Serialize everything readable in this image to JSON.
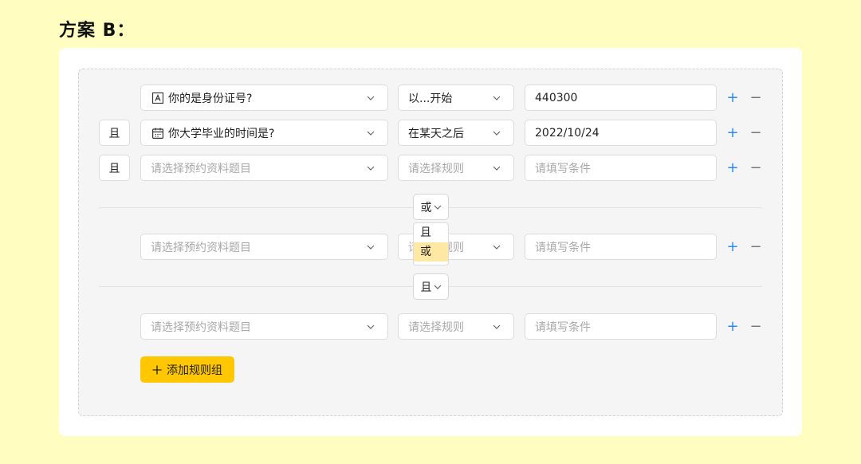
{
  "page_title": "方案 B：",
  "logic_words": {
    "and": "且",
    "or": "或"
  },
  "rows": [
    {
      "question": "你的是身份证号?",
      "question_icon": "text-field-icon",
      "rule": "以...开始",
      "value": "440300"
    },
    {
      "logic": "且",
      "question": "你大学毕业的时间是?",
      "question_icon": "calendar-icon",
      "rule": "在某天之后",
      "value": "2022/10/24"
    },
    {
      "logic": "且",
      "question_placeholder": "请选择预约资料题目",
      "rule_placeholder": "请选择规则",
      "value_placeholder": "请填写条件"
    }
  ],
  "group_connectors": [
    {
      "value": "或",
      "dropdown_open": true,
      "options": [
        "且",
        "或"
      ],
      "selected": "或"
    },
    {
      "value": "且"
    }
  ],
  "group2_row": {
    "question_placeholder": "请选择预约资料题目",
    "rule_placeholder_visible": "请选择规则",
    "value_placeholder": "请填写条件"
  },
  "group3_row": {
    "question_placeholder": "请选择预约资料题目",
    "rule_placeholder": "请选择规则",
    "value_placeholder": "请填写条件"
  },
  "row_ops": {
    "add": "+",
    "remove": "−"
  },
  "add_group_button": {
    "icon": "plus-icon",
    "label": "添加规则组"
  },
  "colors": {
    "background": "#FFFEC0",
    "accent_button": "#FFC700",
    "plus_blue": "#2F8CF5",
    "selected_option": "#FFE8A3"
  }
}
